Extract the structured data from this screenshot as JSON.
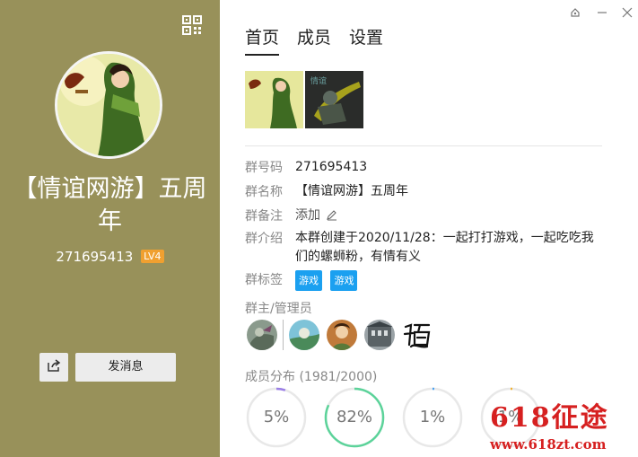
{
  "left": {
    "group_name": "【情谊网游】五周年",
    "group_id": "271695413",
    "level": "LV4",
    "send_label": "发消息",
    "bg_color": "#98915a"
  },
  "tabs": [
    {
      "label": "首页",
      "active": true
    },
    {
      "label": "成员",
      "active": false
    },
    {
      "label": "设置",
      "active": false
    }
  ],
  "info": {
    "id_label": "群号码",
    "id_value": "271695413",
    "name_label": "群名称",
    "name_value": "【情谊网游】五周年",
    "remark_label": "群备注",
    "remark_value": "添加",
    "intro_label": "群介绍",
    "intro_value": "本群创建于2020/11/28：一起打打游戏，一起吃吃我们的螺蛳粉，有情有义",
    "tags_label": "群标签",
    "tags": [
      "游戏",
      "游戏"
    ]
  },
  "admins_title": "群主/管理员",
  "distribution": {
    "title": "成员分布",
    "count": "(1981/2000)",
    "rings": [
      {
        "pct": 5,
        "label": "5%",
        "color": "#9b7fe6"
      },
      {
        "pct": 82,
        "label": "82%",
        "color": "#5cd39a"
      },
      {
        "pct": 1,
        "label": "1%",
        "color": "#4aa0f0"
      },
      {
        "pct": 1,
        "label": "1%",
        "color": "#f0b030"
      }
    ]
  },
  "watermark": {
    "text": "618征途",
    "url": "www.618zt.com"
  },
  "icons": [
    "qr-code-icon",
    "share-icon",
    "pencil-icon",
    "pin-icon",
    "minimize-icon",
    "close-icon"
  ]
}
